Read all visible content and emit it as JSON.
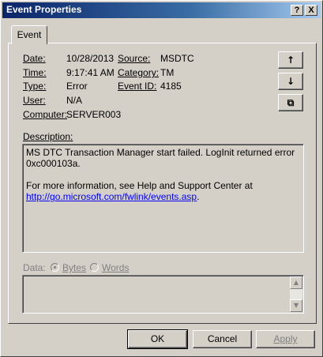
{
  "window": {
    "title": "Event Properties"
  },
  "titlebar": {
    "help_glyph": "?",
    "close_glyph": "X"
  },
  "tabs": [
    {
      "label": "Event"
    }
  ],
  "event": {
    "date_label": "Date:",
    "date": "10/28/2013",
    "time_label": "Time:",
    "time": "9:17:41 AM",
    "type_label": "Type:",
    "type": "Error",
    "user_label": "User:",
    "user": "N/A",
    "computer_label": "Computer:",
    "computer": "SERVER003",
    "source_label": "Source:",
    "source": "MSDTC",
    "category_label": "Category:",
    "category": "TM",
    "event_id_label": "Event ID:",
    "event_id": "4185"
  },
  "nav": {
    "up": "↑",
    "down": "↓",
    "copy": "⧉"
  },
  "description": {
    "label": "Description:",
    "line1": "MS DTC Transaction Manager start failed. LogInit returned error 0xc000103a.",
    "line2": "For more information, see Help and Support Center at",
    "link": "http://go.microsoft.com/fwlink/events.asp",
    "link_suffix": "."
  },
  "data": {
    "label": "Data:",
    "option_bytes": "Bytes",
    "option_words": "Words",
    "selected": "Bytes"
  },
  "buttons": {
    "ok": "OK",
    "cancel": "Cancel",
    "apply": "Apply"
  },
  "colors": {
    "titlebar": "#0a246a",
    "link": "#0000ff",
    "face": "#d4d0c8"
  }
}
